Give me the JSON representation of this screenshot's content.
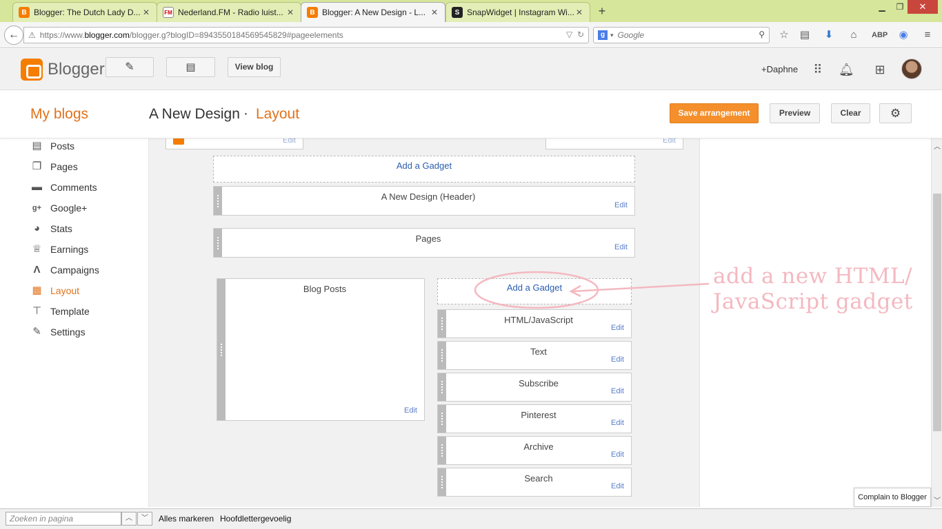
{
  "browser": {
    "tabs": [
      {
        "label": "Blogger: The Dutch Lady D...",
        "icon": "blogger-favicon",
        "active": false
      },
      {
        "label": "Nederland.FM - Radio luist...",
        "icon": "nederlandfm-favicon",
        "active": false
      },
      {
        "label": "Blogger: A New Design - L...",
        "icon": "blogger-favicon",
        "active": true
      },
      {
        "label": "SnapWidget | Instagram Wi...",
        "icon": "snapwidget-favicon",
        "active": false
      }
    ],
    "url_prefix": "https://www.",
    "url_host": "blogger.com",
    "url_path": "/blogger.g?blogID=8943550184569545829#pageelements",
    "search_placeholder": "Google"
  },
  "header": {
    "brand": "Blogger",
    "view_blog_label": "View blog",
    "user_label": "+Daphne"
  },
  "titlebar": {
    "my_blogs": "My blogs",
    "blog_name": "A New Design",
    "separator": "·",
    "page_name": "Layout",
    "save_label": "Save arrangement",
    "preview_label": "Preview",
    "clear_label": "Clear"
  },
  "sidebar": {
    "items": [
      {
        "label": "Posts",
        "icon": "posts-icon"
      },
      {
        "label": "Pages",
        "icon": "pages-icon"
      },
      {
        "label": "Comments",
        "icon": "comments-icon"
      },
      {
        "label": "Google+",
        "icon": "google-plus-icon"
      },
      {
        "label": "Stats",
        "icon": "stats-icon"
      },
      {
        "label": "Earnings",
        "icon": "earnings-icon"
      },
      {
        "label": "Campaigns",
        "icon": "campaigns-icon"
      },
      {
        "label": "Layout",
        "icon": "layout-icon",
        "active": true
      },
      {
        "label": "Template",
        "icon": "template-icon"
      },
      {
        "label": "Settings",
        "icon": "settings-icon"
      }
    ]
  },
  "layout": {
    "edit_label": "Edit",
    "add_gadget_label": "Add a Gadget",
    "header_gadget": "A New Design (Header)",
    "pages_gadget": "Pages",
    "blog_posts_gadget": "Blog Posts",
    "sidebar_gadgets": [
      "HTML/JavaScript",
      "Text",
      "Subscribe",
      "Pinterest",
      "Archive",
      "Search"
    ]
  },
  "annotation": {
    "line1": "add a new HTML/",
    "line2": "JavaScript gadget",
    "color": "#f4b8c0"
  },
  "findbar": {
    "placeholder": "Zoeken in pagina",
    "highlight_all": "Alles markeren",
    "match_case": "Hoofdlettergevoelig"
  },
  "complain_label": "Complain to Blogger",
  "colors": {
    "accent": "#e0721c",
    "save_button": "#f48f2c",
    "link": "#2a5db0"
  }
}
